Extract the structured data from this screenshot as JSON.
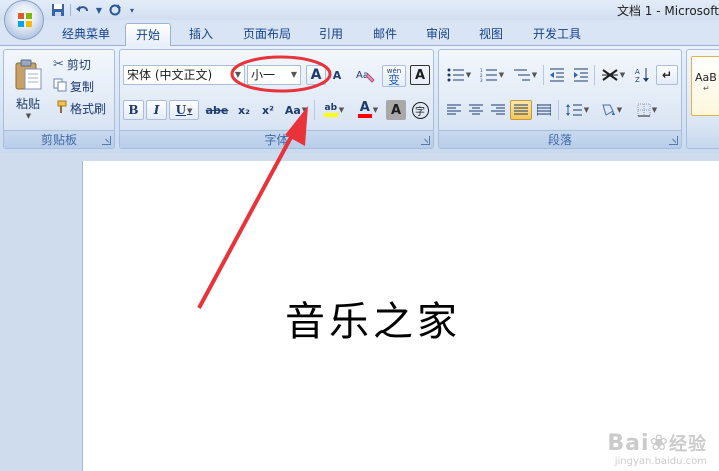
{
  "window": {
    "title": "文档 1 - Microsoft"
  },
  "tabs": [
    "经典菜单",
    "开始",
    "插入",
    "页面布局",
    "引用",
    "邮件",
    "审阅",
    "视图",
    "开发工具"
  ],
  "active_tab": "开始",
  "clipboard": {
    "paste_label": "粘贴",
    "cut_label": "剪切",
    "copy_label": "复制",
    "format_painter_label": "格式刷",
    "group_label": "剪贴板"
  },
  "font": {
    "font_name": "宋体 (中文正文)",
    "font_size": "小一",
    "group_label": "字体",
    "grow_label": "A",
    "shrink_label": "A",
    "phonetic_label": "wén",
    "phonetic_char": "变",
    "char_border_label": "A",
    "bold_label": "B",
    "italic_label": "I",
    "underline_label": "U",
    "strike_label": "abe",
    "subscript_label": "x₂",
    "superscript_label": "x²",
    "case_label": "Aa",
    "highlight_label": "ab",
    "font_color_label": "A",
    "char_shading_label": "A",
    "enclose_label": "字"
  },
  "paragraph": {
    "group_label": "段落"
  },
  "styles": {
    "preview_label": "AaB",
    "preview_sub": "↵"
  },
  "document": {
    "text": "音乐之家"
  },
  "watermark": {
    "logo": "Bai",
    "logo_cn": "经验",
    "url": "jingyan.baidu.com"
  },
  "colors": {
    "accent": "#e8333a",
    "highlight": "#ffff00",
    "font_color": "#ff0000"
  }
}
